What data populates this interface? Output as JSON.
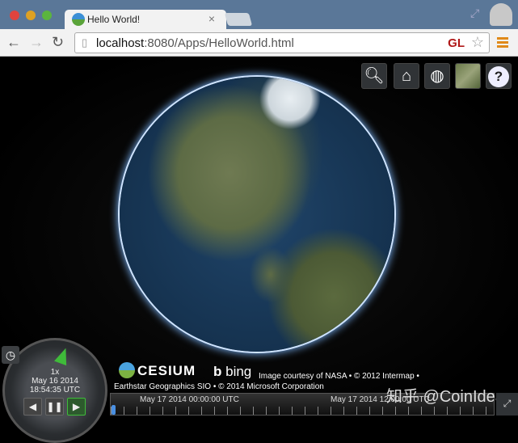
{
  "browser": {
    "tab_title": "Hello World!",
    "url_host": "localhost",
    "url_rest": ":8080/Apps/HelloWorld.html",
    "gl_badge": "GL"
  },
  "toolbar": {
    "buttons": [
      "search",
      "home",
      "globe",
      "imagery",
      "help"
    ]
  },
  "animation": {
    "speed": "1x",
    "date": "May 16 2014",
    "time": "18:54:35 UTC"
  },
  "credits": {
    "line1": "Image courtesy of NASA • © 2012 Intermap •",
    "line2": "Earthstar Geographics SIO • © 2014 Microsoft Corporation",
    "cesium": "CESIUM",
    "bing": "bing"
  },
  "timeline": {
    "labels": [
      "May 17 2014 00:00:00 UTC",
      "May 17 2014 12:00:00 UTC"
    ]
  },
  "watermark": "知乎 @CoinIdea"
}
